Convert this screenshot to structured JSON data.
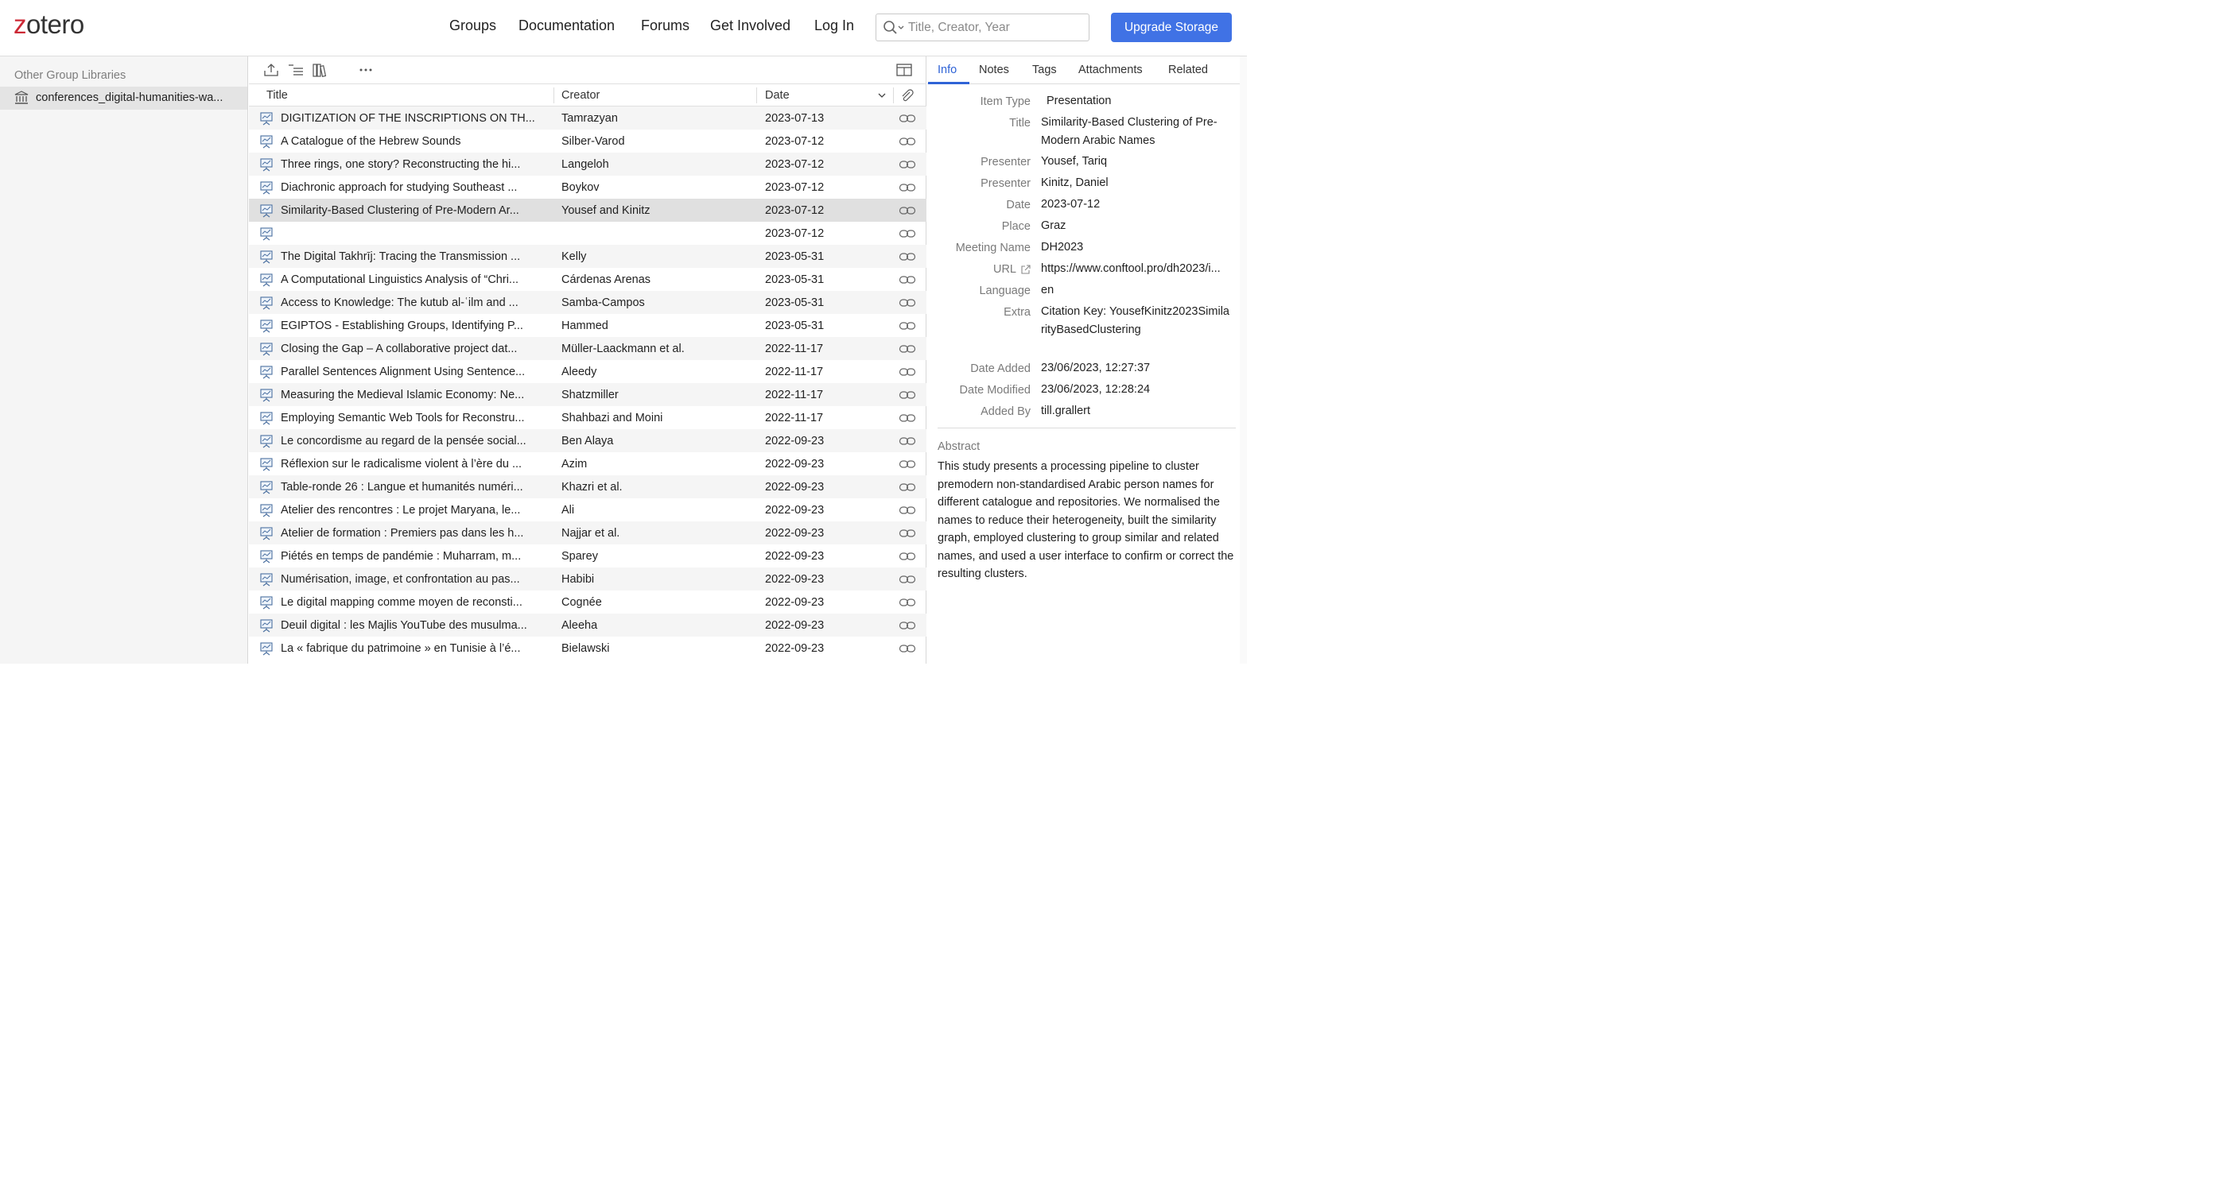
{
  "header": {
    "logo_z": "z",
    "logo_rest": "otero",
    "nav": [
      "Groups",
      "Documentation",
      "Forums",
      "Get Involved",
      "Log In"
    ],
    "search_placeholder": "Title, Creator, Year",
    "upgrade_label": "Upgrade Storage",
    "accent_color": "#4072e5",
    "logo_color": "#cc2936"
  },
  "sidebar": {
    "heading": "Other Group Libraries",
    "library": "conferences_digital-humanities-wa..."
  },
  "items": {
    "columns": {
      "title": "Title",
      "creator": "Creator",
      "date": "Date"
    },
    "rows": [
      {
        "title": "DIGITIZATION OF THE INSCRIPTIONS ON TH...",
        "creator": "Tamrazyan",
        "date": "2023-07-13"
      },
      {
        "title": "A Catalogue of the Hebrew Sounds",
        "creator": "Silber-Varod",
        "date": "2023-07-12"
      },
      {
        "title": "Three rings, one story? Reconstructing the hi...",
        "creator": "Langeloh",
        "date": "2023-07-12"
      },
      {
        "title": "Diachronic approach for studying Southeast ...",
        "creator": "Boykov",
        "date": "2023-07-12"
      },
      {
        "title": "Similarity-Based Clustering of Pre-Modern Ar...",
        "creator": "Yousef and Kinitz",
        "date": "2023-07-12",
        "selected": true
      },
      {
        "title": "",
        "creator": "",
        "date": "2023-07-12"
      },
      {
        "title": "The Digital Takhrīj: Tracing the Transmission ...",
        "creator": "Kelly",
        "date": "2023-05-31"
      },
      {
        "title": "A Computational Linguistics Analysis of “Chri...",
        "creator": "Cárdenas Arenas",
        "date": "2023-05-31"
      },
      {
        "title": "Access to Knowledge: The kutub al-ʿilm and ...",
        "creator": "Samba-Campos",
        "date": "2023-05-31"
      },
      {
        "title": "EGIPTOS - Establishing Groups, Identifying P...",
        "creator": "Hammed",
        "date": "2023-05-31"
      },
      {
        "title": "Closing the Gap – A collaborative project dat...",
        "creator": "Müller-Laackmann et al.",
        "date": "2022-11-17"
      },
      {
        "title": "Parallel Sentences Alignment Using Sentence...",
        "creator": "Aleedy",
        "date": "2022-11-17"
      },
      {
        "title": "Measuring the Medieval Islamic Economy: Ne...",
        "creator": "Shatzmiller",
        "date": "2022-11-17"
      },
      {
        "title": "Employing Semantic Web Tools for Reconstru...",
        "creator": "Shahbazi and Moini",
        "date": "2022-11-17"
      },
      {
        "title": "Le concordisme au regard de la pensée social...",
        "creator": "Ben Alaya",
        "date": "2022-09-23"
      },
      {
        "title": "Réflexion sur le radicalisme violent à l’ère du ...",
        "creator": "Azim",
        "date": "2022-09-23"
      },
      {
        "title": "Table-ronde 26 : Langue et humanités numéri...",
        "creator": "Khazri et al.",
        "date": "2022-09-23"
      },
      {
        "title": "Atelier des rencontres : Le projet Maryana, le...",
        "creator": "Ali",
        "date": "2022-09-23"
      },
      {
        "title": "Atelier de formation : Premiers pas dans les h...",
        "creator": "Najjar et al.",
        "date": "2022-09-23"
      },
      {
        "title": "Piétés en temps de pandémie : Muharram, m...",
        "creator": "Sparey",
        "date": "2022-09-23"
      },
      {
        "title": "Numérisation, image, et confrontation au pas...",
        "creator": "Habibi",
        "date": "2022-09-23"
      },
      {
        "title": "Le digital mapping comme moyen de reconsti...",
        "creator": "Cognée",
        "date": "2022-09-23"
      },
      {
        "title": "Deuil digital : les Majlis YouTube des musulma...",
        "creator": "Aleeha",
        "date": "2022-09-23"
      },
      {
        "title": "La « fabrique du patrimoine » en Tunisie à l’é...",
        "creator": "Bielawski",
        "date": "2022-09-23"
      }
    ]
  },
  "details": {
    "tabs": [
      "Info",
      "Notes",
      "Tags",
      "Attachments",
      "Related"
    ],
    "active_tab": "Info",
    "fields": [
      {
        "label": "Item Type",
        "value": "Presentation"
      },
      {
        "label": "Title",
        "value": "Similarity-Based Clustering of Pre-Modern Arabic Names"
      },
      {
        "label": "Presenter",
        "value": "Yousef, Tariq"
      },
      {
        "label": "Presenter",
        "value": "Kinitz, Daniel"
      },
      {
        "label": "Date",
        "value": "2023-07-12"
      },
      {
        "label": "Place",
        "value": "Graz"
      },
      {
        "label": "Meeting Name",
        "value": "DH2023"
      },
      {
        "label": "URL",
        "value": "https://www.conftool.pro/dh2023/i..."
      },
      {
        "label": "Language",
        "value": "en"
      },
      {
        "label": "Extra",
        "value": "Citation Key: YousefKinitz2023SimilarityBasedClustering"
      },
      {
        "label": "Date Added",
        "value": "23/06/2023, 12:27:37"
      },
      {
        "label": "Date Modified",
        "value": "23/06/2023, 12:28:24"
      },
      {
        "label": "Added By",
        "value": "till.grallert"
      }
    ],
    "abstract_label": "Abstract",
    "abstract": "This study presents a processing pipeline to cluster premodern non-standardised Arabic person names for different catalogue and repositories. We normalised the names to reduce their heterogeneity, built the similarity graph, employed clustering to group similar and related names, and used a user interface to confirm or correct the resulting clusters."
  }
}
